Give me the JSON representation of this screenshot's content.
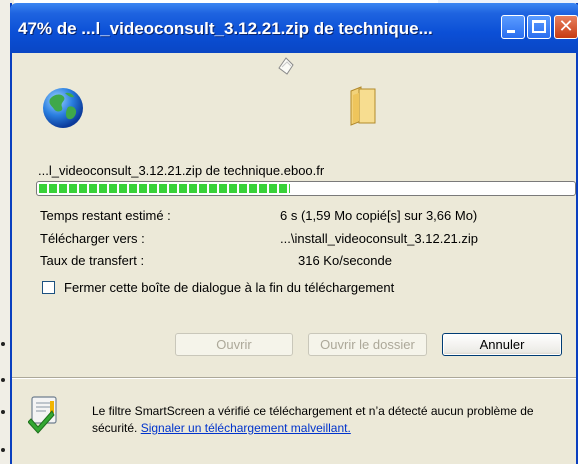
{
  "window": {
    "title": "47% de ...l_videoconsult_3.12.21.zip de technique...",
    "buttons": {
      "minimize": "minimize-icon",
      "maximize": "maximize-icon",
      "close_glyph": "✕"
    }
  },
  "download": {
    "source": "...l_videoconsult_3.12.21.zip de technique.eboo.fr",
    "progress_percent": 47,
    "time_label": "Temps restant estimé :",
    "time_value": "6 s (1,59 Mo copié[s] sur 3,66 Mo)",
    "dest_label": "Télécharger vers :",
    "dest_value": "...\\install_videoconsult_3.12.21.zip",
    "rate_label": "Taux de transfert :",
    "rate_value": "316 Ko/seconde"
  },
  "options": {
    "close_on_finish_label": "Fermer cette boîte de dialogue à la fin du téléchargement",
    "close_on_finish_checked": false
  },
  "buttons": {
    "open": "Ouvrir",
    "open_folder": "Ouvrir le dossier",
    "cancel": "Annuler"
  },
  "smartscreen": {
    "text": "Le filtre SmartScreen a vérifié ce téléchargement et n’a détecté aucun problème de sécurité. ",
    "link": "Signaler un téléchargement malveillant."
  },
  "icons": {
    "globe": "globe-icon",
    "folder": "folder-icon",
    "paper": "flying-paper-icon",
    "shield": "smartscreen-check-icon"
  },
  "colors": {
    "title_bar": "#0a46c4",
    "progress": "#38d238",
    "link": "#0033cc"
  }
}
